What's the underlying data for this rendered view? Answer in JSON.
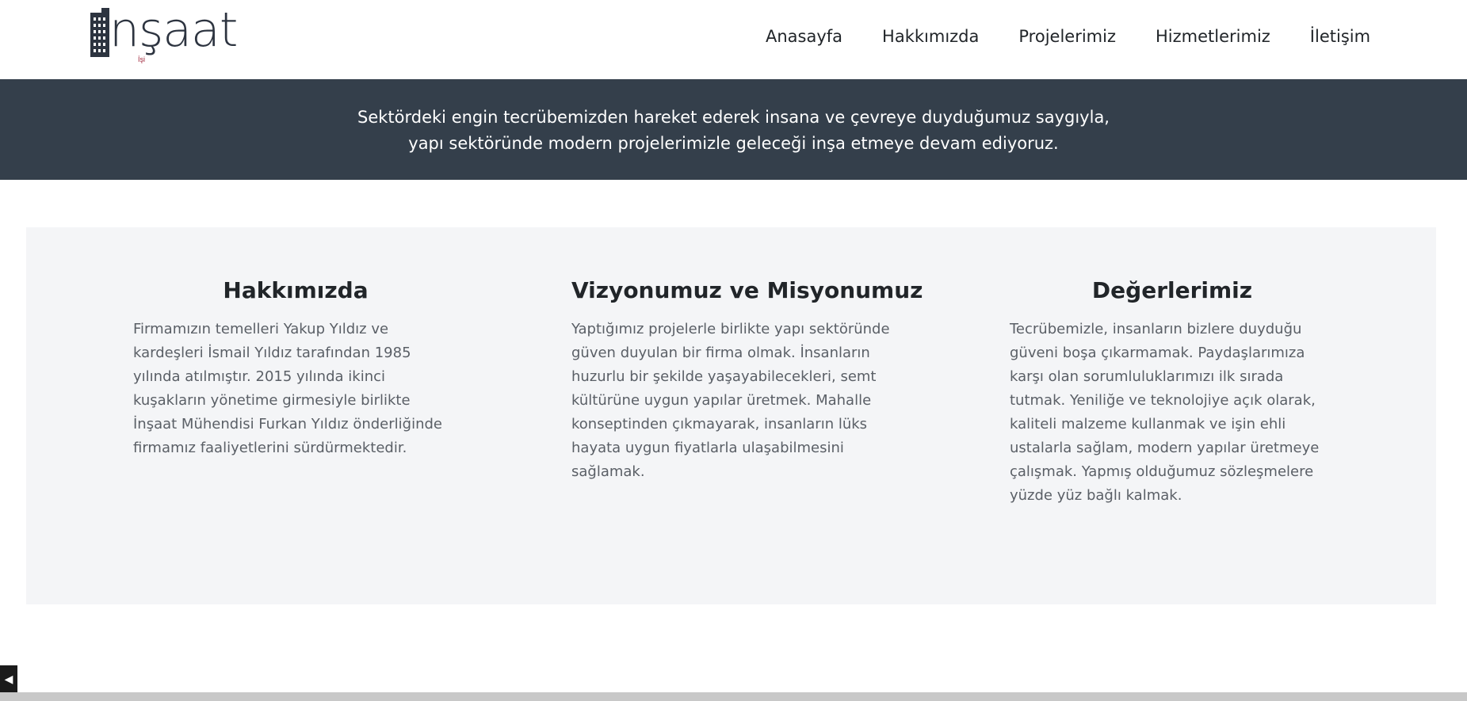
{
  "header": {
    "logo_text": "nşaat",
    "logo_sub": "İşi",
    "nav": [
      "Anasayfa",
      "Hakkımızda",
      "Projelerimiz",
      "Hizmetlerimiz",
      "İletişim"
    ]
  },
  "banner": {
    "line1": "Sektördeki engin tecrübemizden hareket ederek insana ve çevreye duyduğumuz saygıyla,",
    "line2": "yapı sektöründe modern projelerimizle geleceği inşa etmeye devam ediyoruz."
  },
  "sections": [
    {
      "title": "Hakkımızda",
      "text": "Firmamızın temelleri Yakup Yıldız ve kardeşleri İsmail Yıldız tarafından 1985 yılında atılmıştır. 2015 yılında ikinci kuşakların yönetime girmesiyle birlikte İnşaat Mühendisi Furkan Yıldız önderliğinde firmamız faaliyetlerini sürdürmektedir."
    },
    {
      "title": "Vizyonumuz ve Misyonumuz",
      "text": "Yaptığımız projelerle birlikte yapı sektöründe güven duyulan bir firma olmak. İnsanların huzurlu bir şekilde yaşayabilecekleri, semt kültürüne uygun yapılar üretmek. Mahalle konseptinden çıkmayarak, insanların lüks hayata uygun fiyatlarla ulaşabilmesini sağlamak."
    },
    {
      "title": "Değerlerimiz",
      "text": "Tecrübemizle, insanların bizlere duyduğu güveni boşa çıkarmamak. Paydaşlarımıza karşı olan sorumluluklarımızı ilk sırada tutmak. Yeniliğe ve teknolojiye açık olarak, kaliteli malzeme kullanmak ve işin ehli ustalarla sağlam, modern yapılar üretmeye çalışmak. Yapmış olduğumuz sözleşmelere yüzde yüz bağlı kalmak."
    }
  ],
  "corner_button": {
    "icon": "play-left-icon",
    "glyph": "◀"
  },
  "colors": {
    "banner": "#343f4b",
    "section_bg": "#f4f5f7",
    "logo_accent": "#a0263b"
  }
}
